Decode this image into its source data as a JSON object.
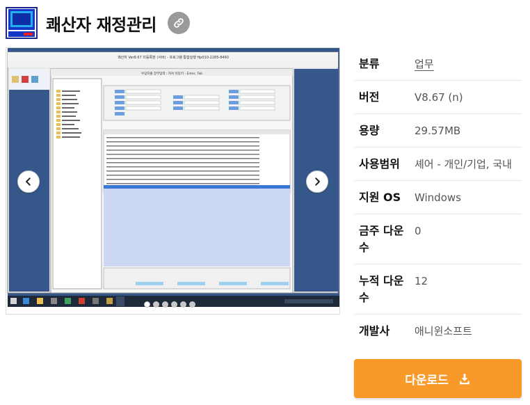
{
  "header": {
    "title": "쾌산자 재정관리"
  },
  "carousel": {
    "slide_count": 6,
    "active_index": 0,
    "window_title": "쾌산자 Ver8.67 미등록판 (서버) - 프로그램 통합실행 Hp010-2285-8460",
    "inner_title": "수입지출 장부입력 : 커서 이동키 - Enter, Tab"
  },
  "info": {
    "rows": [
      {
        "label": "분류",
        "value": "업무",
        "link": true
      },
      {
        "label": "버전",
        "value": "V8.67 (n)"
      },
      {
        "label": "용량",
        "value": "29.57MB"
      },
      {
        "label": "사용범위",
        "value": "셰어 - 개인/기업, 국내"
      },
      {
        "label": "지원 OS",
        "value": "Windows"
      },
      {
        "label": "금주 다운수",
        "value": "0"
      },
      {
        "label": "누적 다운수",
        "value": "12"
      },
      {
        "label": "개발사",
        "value": "애니윈소프트"
      }
    ]
  },
  "download": {
    "label": "다운로드"
  },
  "colors": {
    "accent": "#f8992a",
    "link_button": "#9a9a9a",
    "desktop_blue": "#35578a"
  }
}
